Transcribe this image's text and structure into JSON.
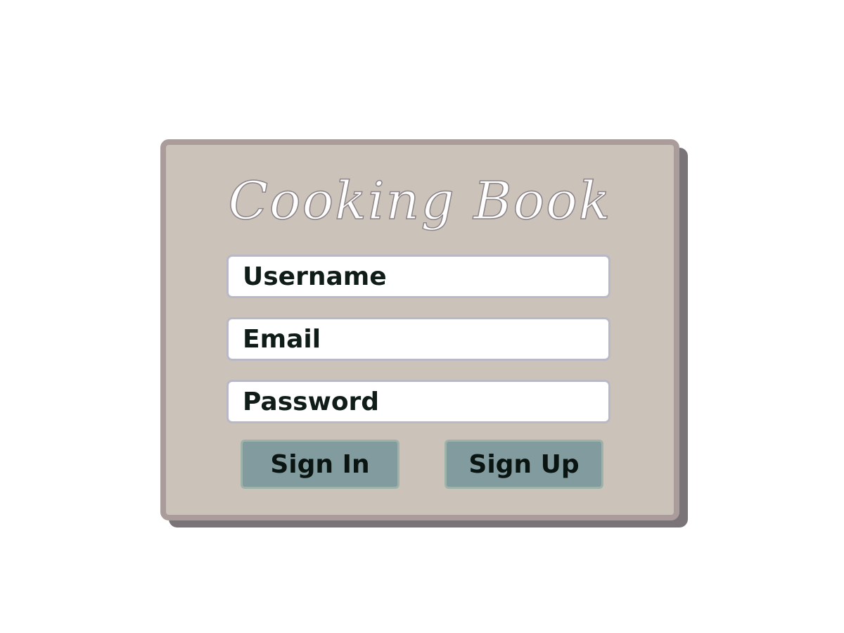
{
  "app": {
    "title": "Cooking Book"
  },
  "form": {
    "username_placeholder": "Username",
    "email_placeholder": "Email",
    "password_placeholder": "Password"
  },
  "actions": {
    "sign_in_label": "Sign In",
    "sign_up_label": "Sign Up"
  },
  "colors": {
    "card_background": "#cbc2b9",
    "card_border": "#ab9c9c",
    "card_shadow": "#7a7478",
    "button_background": "#829b9f",
    "field_border": "#b9b8c6"
  }
}
